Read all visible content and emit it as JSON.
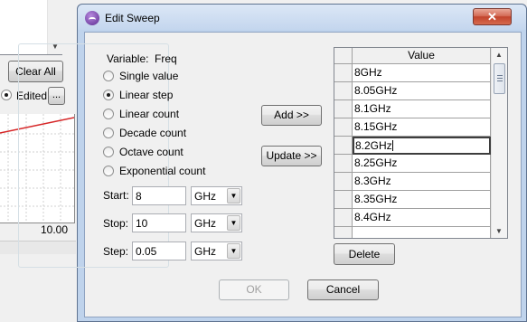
{
  "background": {
    "clear_all_label": "Clear All",
    "edited_label": "Edited",
    "more_label": "...",
    "x_tick": "10.00",
    "plot_line_color": "#d62728"
  },
  "dialog": {
    "title": "Edit Sweep",
    "close_glyph": "✕",
    "variable_label": "Variable:",
    "variable_value": "Freq",
    "sweep_types": [
      {
        "label": "Single value",
        "checked": false
      },
      {
        "label": "Linear step",
        "checked": true
      },
      {
        "label": "Linear count",
        "checked": false
      },
      {
        "label": "Decade count",
        "checked": false
      },
      {
        "label": "Octave count",
        "checked": false
      },
      {
        "label": "Exponential count",
        "checked": false
      }
    ],
    "start": {
      "label": "Start:",
      "value": "8",
      "unit": "GHz"
    },
    "stop": {
      "label": "Stop:",
      "value": "10",
      "unit": "GHz"
    },
    "step": {
      "label": "Step:",
      "value": "0.05",
      "unit": "GHz"
    },
    "add_label": "Add  >>",
    "update_label": "Update >>",
    "ok_label": "OK",
    "cancel_label": "Cancel",
    "delete_label": "Delete",
    "grid": {
      "header": "Value",
      "rows": [
        "8GHz",
        "8.05GHz",
        "8.1GHz",
        "8.15GHz",
        "8.2GHz",
        "8.25GHz",
        "8.3GHz",
        "8.35GHz",
        "8.4GHz",
        ""
      ],
      "active_row": 4
    }
  },
  "icons": {
    "app": "app-logo-icon",
    "combo_arrow": "▼",
    "scroll_up": "▲",
    "scroll_down": "▼"
  }
}
